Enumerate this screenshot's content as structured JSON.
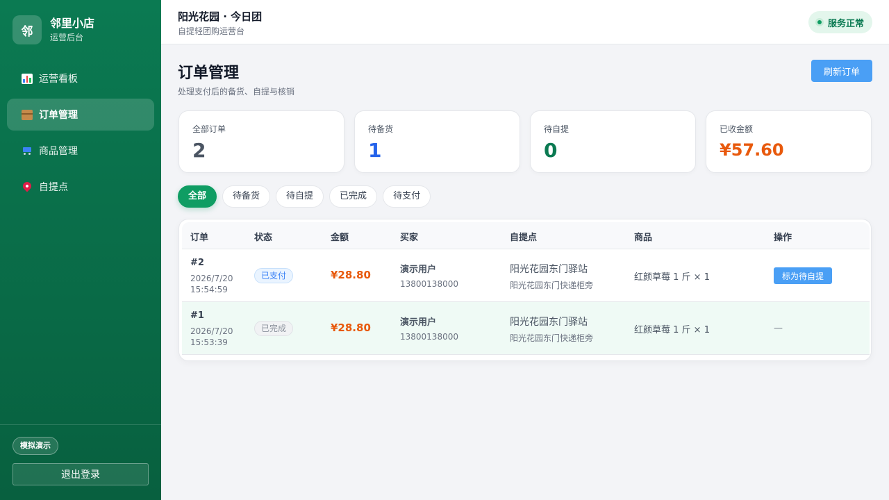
{
  "brand": {
    "logo": "邻",
    "name": "邻里小店",
    "subtitle": "运营后台"
  },
  "nav": [
    {
      "label": "运营看板",
      "icon": "bar-chart-icon",
      "active": false
    },
    {
      "label": "订单管理",
      "icon": "package-icon",
      "active": true
    },
    {
      "label": "商品管理",
      "icon": "shopping-cart-icon",
      "active": false
    },
    {
      "label": "自提点",
      "icon": "location-pin-icon",
      "active": false
    }
  ],
  "sidebar_footer": {
    "demo_badge": "模拟演示",
    "logout_label": "退出登录"
  },
  "header": {
    "title": "阳光花园 · 今日团",
    "subtitle": "自提轻团购运营台",
    "status": "服务正常"
  },
  "page": {
    "title": "订单管理",
    "subtitle": "处理支付后的备货、自提与核销",
    "refresh_label": "刷新订单"
  },
  "stats": [
    {
      "label": "全部订单",
      "value": "2",
      "color": "#4b5563"
    },
    {
      "label": "待备货",
      "value": "1",
      "color": "#2563eb"
    },
    {
      "label": "待自提",
      "value": "0",
      "color": "#0b7a52"
    },
    {
      "label": "已收金额",
      "value": "¥57.60",
      "color": "#e8590c"
    }
  ],
  "filters": [
    {
      "label": "全部",
      "active": true
    },
    {
      "label": "待备货",
      "active": false
    },
    {
      "label": "待自提",
      "active": false
    },
    {
      "label": "已完成",
      "active": false
    },
    {
      "label": "待支付",
      "active": false
    }
  ],
  "table": {
    "headers": [
      "订单",
      "状态",
      "金额",
      "买家",
      "自提点",
      "商品",
      "操作"
    ],
    "rows": [
      {
        "order_no": "#2",
        "date": "2026/7/20",
        "time": "15:54:59",
        "status": "已支付",
        "status_type": "paid",
        "amount": "¥28.80",
        "buyer": "演示用户",
        "phone": "13800138000",
        "pickup": "阳光花园东门驿站",
        "pickup_detail": "阳光花园东门快递柜旁",
        "goods": "红颜草莓 1 斤 × 1",
        "action": "标为待自提"
      },
      {
        "order_no": "#1",
        "date": "2026/7/20",
        "time": "15:53:39",
        "status": "已完成",
        "status_type": "done",
        "amount": "¥28.80",
        "buyer": "演示用户",
        "phone": "13800138000",
        "pickup": "阳光花园东门驿站",
        "pickup_detail": "阳光花园东门快递柜旁",
        "goods": "红颜草莓 1 斤 × 1",
        "action": "—"
      }
    ]
  }
}
